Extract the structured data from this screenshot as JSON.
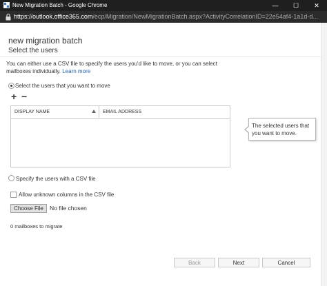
{
  "window": {
    "title": "New Migration Batch - Google Chrome",
    "minimize_glyph": "—",
    "maximize_glyph": "☐",
    "close_glyph": "✕"
  },
  "address_bar": {
    "url_host": "https://outlook.office365.com",
    "url_path": "/ecp/Migration/NewMigrationBatch.aspx?ActivityCorrelationID=22e54af4-1a1d-d..."
  },
  "header": {
    "title": "new migration batch",
    "subtitle": "Select the users"
  },
  "intro": {
    "text": "You can either use a CSV file to specify the users you'd like to move, or you can select mailboxes individually. ",
    "learn_more": "Learn more"
  },
  "options": {
    "select_users_label": "Select the users that you want to move",
    "csv_label": "Specify the users with a CSV file",
    "allow_unknown_label": "Allow unknown columns in the CSV file"
  },
  "toolbar": {
    "add_glyph": "+",
    "remove_glyph": "−"
  },
  "grid": {
    "columns": [
      "DISPLAY NAME",
      "EMAIL ADDRESS"
    ]
  },
  "callout": {
    "text": "The selected users that you want to move."
  },
  "file": {
    "choose_label": "Choose File",
    "status": "No file chosen"
  },
  "count": {
    "text": "0 mailboxes to migrate"
  },
  "footer": {
    "back_label": "Back",
    "next_label": "Next",
    "cancel_label": "Cancel"
  }
}
